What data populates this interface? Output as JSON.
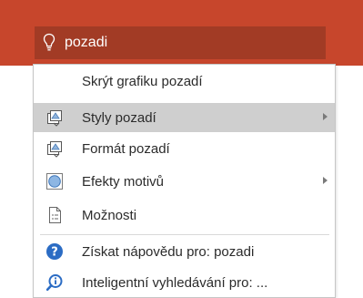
{
  "search": {
    "query": "pozadi",
    "icon": "lightbulb-icon"
  },
  "colors": {
    "ribbon": "#c7462c",
    "search_box": "#a23b25",
    "highlight": "#cfcfcf",
    "help_blue": "#2b6cc4"
  },
  "menu": {
    "items": [
      {
        "label": "Skrýt grafiku pozadí",
        "icon": "none",
        "submenu": false,
        "highlighted": false
      },
      {
        "label": "Styly pozadí",
        "icon": "background-styles-icon",
        "submenu": true,
        "highlighted": true
      },
      {
        "label": "Formát pozadí",
        "icon": "format-background-icon",
        "submenu": false,
        "highlighted": false
      },
      {
        "label": "Efekty motivů",
        "icon": "theme-effects-icon",
        "submenu": true,
        "highlighted": false
      },
      {
        "label": "Možnosti",
        "icon": "options-icon",
        "submenu": false,
        "highlighted": false
      }
    ],
    "help": [
      {
        "label": "Získat nápovědu pro: pozadi",
        "icon": "help-icon"
      },
      {
        "label": "Inteligentní vyhledávání pro: ...",
        "icon": "smart-lookup-icon"
      }
    ]
  }
}
